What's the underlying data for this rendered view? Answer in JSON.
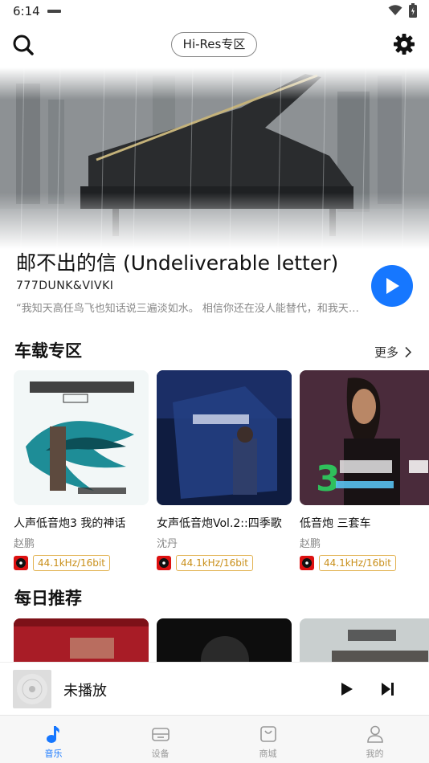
{
  "status_bar": {
    "time": "6:14"
  },
  "header": {
    "hires_label": "Hi-Res专区"
  },
  "featured": {
    "title": "邮不出的信 (Undeliverable letter)",
    "artist": "777DUNK&VIVKI",
    "quote": "“我知天高任鸟飞也知话说三遍淡如水。 相信你还在没人能替代，和我天各一方"
  },
  "car_section": {
    "title": "车载专区",
    "more_label": "更多",
    "albums": [
      {
        "name": "人声低音炮3 我的神话",
        "artist": "赵鹏",
        "quality": "44.1kHz/16bit"
      },
      {
        "name": "女声低音炮Vol.2::四季歌",
        "artist": "沈丹",
        "quality": "44.1kHz/16bit"
      },
      {
        "name": "低音炮 三套车",
        "artist": "赵鹏",
        "quality": "44.1kHz/16bit"
      }
    ]
  },
  "daily_section": {
    "title": "每日推荐"
  },
  "mini_player": {
    "status": "未播放"
  },
  "bottom_nav": {
    "items": [
      {
        "label": "音乐",
        "icon": "music-note-icon",
        "active": true
      },
      {
        "label": "设备",
        "icon": "device-icon",
        "active": false
      },
      {
        "label": "商城",
        "icon": "shop-bag-icon",
        "active": false
      },
      {
        "label": "我的",
        "icon": "profile-icon",
        "active": false
      }
    ]
  },
  "colors": {
    "accent": "#1677ff",
    "quality_border": "#e2b251",
    "quality_text": "#c98f1a"
  }
}
